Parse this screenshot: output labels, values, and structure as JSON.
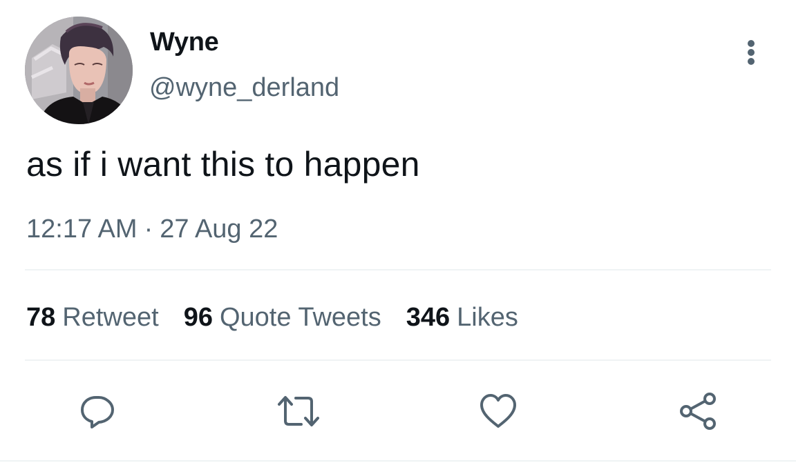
{
  "author": {
    "display_name": "Wyne",
    "handle": "@wyne_derland"
  },
  "tweet": {
    "text": "as if i want this to happen",
    "time": "12:17 AM",
    "separator": "·",
    "date": "27 Aug 22"
  },
  "stats": [
    {
      "count": "78",
      "label": "Retweet"
    },
    {
      "count": "96",
      "label": "Quote Tweets"
    },
    {
      "count": "346",
      "label": "Likes"
    }
  ],
  "actions": {
    "reply_icon": "reply-icon",
    "retweet_icon": "retweet-icon",
    "like_icon": "heart-icon",
    "share_icon": "share-icon"
  },
  "colors": {
    "text_primary": "#0f1419",
    "text_secondary": "#536471",
    "divider": "#eff3f4",
    "background": "#ffffff"
  }
}
